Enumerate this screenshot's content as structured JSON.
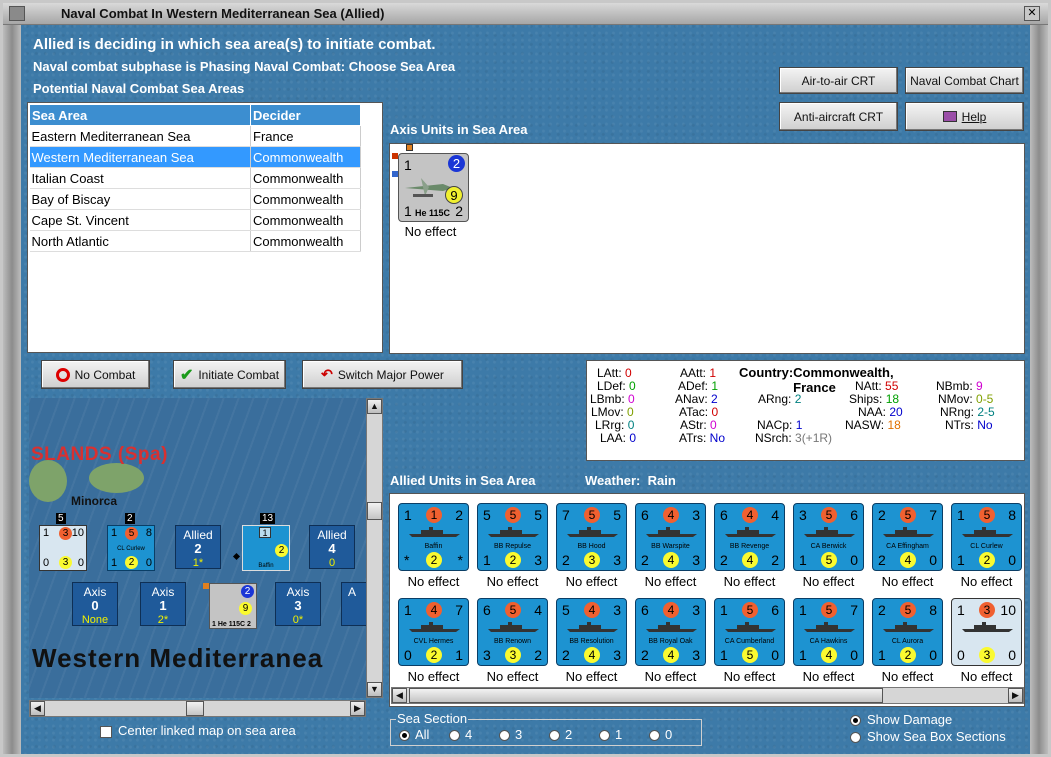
{
  "window": {
    "title": "Naval Combat In Western Mediterranean Sea (Allied)"
  },
  "header": {
    "line1": "Allied is deciding in which sea area(s) to initiate combat.",
    "line2": "Naval combat subphase is Phasing Naval Combat: Choose Sea Area",
    "line3": "Potential Naval Combat Sea Areas"
  },
  "buttons": {
    "air_to_air": "Air-to-air CRT",
    "naval_combat_chart": "Naval Combat Chart",
    "anti_aircraft": "Anti-aircraft CRT",
    "help": "Help",
    "no_combat": "No Combat",
    "initiate_combat": "Initiate Combat",
    "switch_major_power": "Switch Major Power"
  },
  "sea_table": {
    "headers": [
      "Sea Area",
      "Decider"
    ],
    "rows": [
      {
        "area": "Eastern Mediterranean Sea",
        "decider": "France"
      },
      {
        "area": "Western Mediterranean Sea",
        "decider": "Commonwealth",
        "selected": true
      },
      {
        "area": "Italian Coast",
        "decider": "Commonwealth"
      },
      {
        "area": "Bay of Biscay",
        "decider": "Commonwealth"
      },
      {
        "area": "Cape St. Vincent",
        "decider": "Commonwealth"
      },
      {
        "area": "North Atlantic",
        "decider": "Commonwealth"
      }
    ]
  },
  "axis_units": {
    "label": "Axis Units in Sea Area",
    "unit": {
      "name": "He 115C",
      "tl": "1",
      "tr": "2",
      "bl": "1",
      "br": "2",
      "circle": "9",
      "effect": "No effect"
    }
  },
  "stats": {
    "latt": "0",
    "ldef": "0",
    "lbmb": "0",
    "lmov": "0",
    "lrg": "0",
    "laa": "0",
    "aatt": "1",
    "adef": "1",
    "anav": "2",
    "atac": "0",
    "astr": "0",
    "atrs": "No",
    "arng": "2",
    "nacp": "1",
    "nsrch": "3(+1R)",
    "country": "Commonwealth, France",
    "natt": "55",
    "ships": "18",
    "naa": "20",
    "nasw": "18",
    "nbmb": "9",
    "nmov": "0-5",
    "nrng": "2-5",
    "ntrs": "No"
  },
  "allied_units": {
    "label": "Allied Units in Sea Area",
    "weather_label": "Weather:",
    "weather": "Rain",
    "row1": [
      {
        "name": "Baffin",
        "tl": "1",
        "tr": "2",
        "bl": "*",
        "br": "*",
        "top": "1",
        "bot": "2",
        "effect": "No effect",
        "type": "carrier"
      },
      {
        "name": "BB Repulse",
        "tl": "5",
        "tr": "5",
        "bl": "1",
        "br": "3",
        "top": "5",
        "bot": "2",
        "effect": "No effect"
      },
      {
        "name": "BB Hood",
        "tl": "7",
        "tr": "5",
        "bl": "2",
        "br": "3",
        "top": "5",
        "bot": "3",
        "effect": "No effect"
      },
      {
        "name": "BB Warspite",
        "tl": "6",
        "tr": "3",
        "bl": "2",
        "br": "3",
        "top": "4",
        "bot": "4",
        "effect": "No effect"
      },
      {
        "name": "BB Revenge",
        "tl": "6",
        "tr": "4",
        "bl": "2",
        "br": "2",
        "top": "4",
        "bot": "4",
        "effect": "No effect"
      },
      {
        "name": "CA Berwick",
        "tl": "3",
        "tr": "6",
        "bl": "1",
        "br": "0",
        "top": "5",
        "bot": "5",
        "effect": "No effect"
      },
      {
        "name": "CA Effingham",
        "tl": "2",
        "tr": "7",
        "bl": "2",
        "br": "0",
        "top": "5",
        "bot": "4",
        "effect": "No effect"
      },
      {
        "name": "CL Curlew",
        "tl": "1",
        "tr": "8",
        "bl": "1",
        "br": "0",
        "top": "5",
        "bot": "2",
        "effect": "No effect"
      }
    ],
    "row2": [
      {
        "name": "CVL Hermes",
        "tl": "1",
        "tr": "7",
        "bl": "0",
        "br": "1",
        "top": "4",
        "bot": "2",
        "effect": "No effect"
      },
      {
        "name": "BB Renown",
        "tl": "6",
        "tr": "4",
        "bl": "3",
        "br": "2",
        "top": "5",
        "bot": "3",
        "effect": "No effect"
      },
      {
        "name": "BB Resolution",
        "tl": "5",
        "tr": "3",
        "bl": "2",
        "br": "3",
        "top": "4",
        "bot": "4",
        "effect": "No effect"
      },
      {
        "name": "BB Royal Oak",
        "tl": "6",
        "tr": "3",
        "bl": "2",
        "br": "3",
        "top": "4",
        "bot": "4",
        "effect": "No effect"
      },
      {
        "name": "CA Cumberland",
        "tl": "1",
        "tr": "6",
        "bl": "1",
        "br": "0",
        "top": "5",
        "bot": "5",
        "effect": "No effect"
      },
      {
        "name": "CA Hawkins",
        "tl": "1",
        "tr": "7",
        "bl": "1",
        "br": "0",
        "top": "5",
        "bot": "4",
        "effect": "No effect"
      },
      {
        "name": "CL Aurora",
        "tl": "2",
        "tr": "8",
        "bl": "1",
        "br": "0",
        "top": "5",
        "bot": "2",
        "effect": "No effect"
      },
      {
        "name": "",
        "tl": "1",
        "tr": "10",
        "bl": "0",
        "br": "0",
        "top": "3",
        "bot": "3",
        "effect": "No effect",
        "type": "stack"
      }
    ]
  },
  "map": {
    "region": "SLANDS (Spa)",
    "island": "Minorca",
    "sea_name": "Western Mediterranea",
    "boxes": [
      {
        "side": "Allied",
        "n": "2",
        "s": "1*"
      },
      {
        "side": "Allied",
        "n": "4",
        "s": "0"
      },
      {
        "side": "Axis",
        "n": "0",
        "s": "None"
      },
      {
        "side": "Axis",
        "n": "1",
        "s": "2*"
      },
      {
        "side": "Axis",
        "n": "3",
        "s": "0*"
      }
    ],
    "stack_counts": [
      "5",
      "2",
      "13"
    ],
    "curlew_name": "CL Curlew",
    "baffin_name": "Baffin",
    "he_name": "He 115C"
  },
  "footer": {
    "center_map": "Center linked map on sea area",
    "sea_section": "Sea Section",
    "options": [
      "All",
      "4",
      "3",
      "2",
      "1",
      "0"
    ],
    "show_damage": "Show Damage",
    "show_sea_box": "Show Sea Box Sections"
  }
}
